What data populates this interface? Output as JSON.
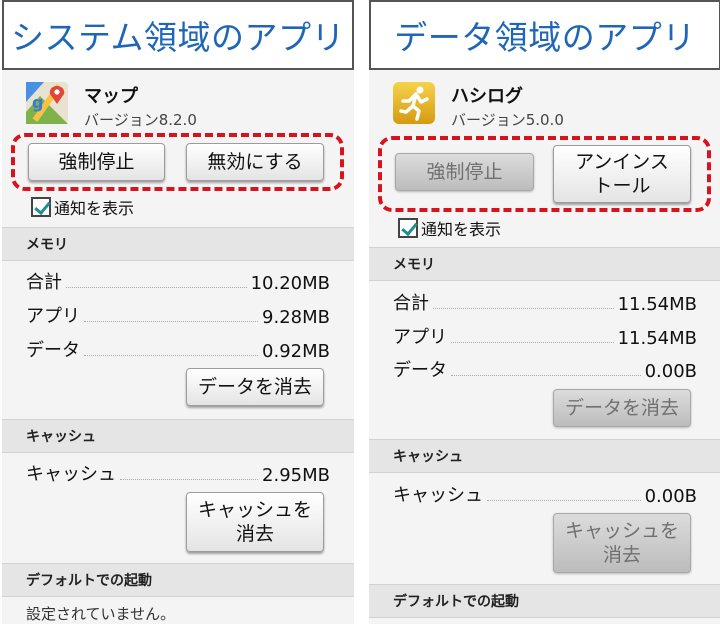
{
  "left": {
    "title": "システム領域のアプリ",
    "app": {
      "name": "マップ",
      "version": "バージョン8.2.0",
      "icon": "google-maps-icon"
    },
    "buttons": {
      "force_stop": "強制停止",
      "disable": "無効にする"
    },
    "notify_label": "通知を表示",
    "memory": {
      "header": "メモリ",
      "rows": [
        {
          "label": "合計",
          "value": "10.20MB"
        },
        {
          "label": "アプリ",
          "value": "9.28MB"
        },
        {
          "label": "データ",
          "value": "0.92MB"
        }
      ],
      "clear_data": "データを消去"
    },
    "cache": {
      "header": "キャッシュ",
      "label": "キャッシュ",
      "value": "2.95MB",
      "clear_line1": "キャッシュを",
      "clear_line2": "消去"
    },
    "default_launch": {
      "header": "デフォルトでの起動",
      "text": "設定されていません。"
    }
  },
  "right": {
    "title": "データ領域のアプリ",
    "app": {
      "name": "ハシログ",
      "version": "バージョン5.0.0",
      "icon": "running-man-icon"
    },
    "buttons": {
      "force_stop": "強制停止",
      "uninstall_line1": "アンインス",
      "uninstall_line2": "トール"
    },
    "notify_label": "通知を表示",
    "memory": {
      "header": "メモリ",
      "rows": [
        {
          "label": "合計",
          "value": "11.54MB"
        },
        {
          "label": "アプリ",
          "value": "11.54MB"
        },
        {
          "label": "データ",
          "value": "0.00B"
        }
      ],
      "clear_data": "データを消去"
    },
    "cache": {
      "header": "キャッシュ",
      "label": "キャッシュ",
      "value": "0.00B",
      "clear_line1": "キャッシュを",
      "clear_line2": "消去"
    },
    "default_launch": {
      "header": "デフォルトでの起動"
    }
  },
  "colors": {
    "title_text": "#1f66b8",
    "highlight": "#d7141e",
    "check": "#1d8f8f"
  }
}
